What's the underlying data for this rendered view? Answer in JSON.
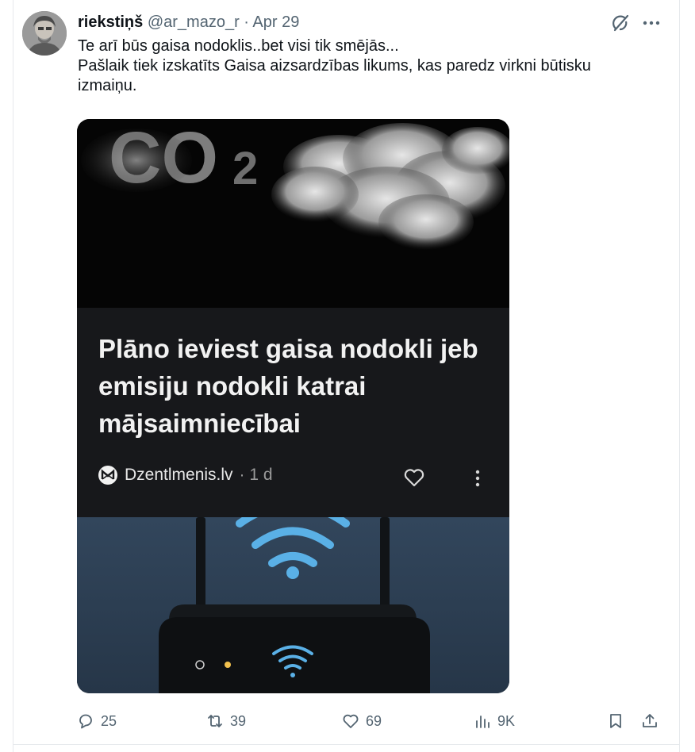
{
  "tweet": {
    "author_name": "riekstiņš",
    "handle": "@ar_mazo_r",
    "separator": "·",
    "date": "Apr 29",
    "text_line1": "Te arī būs gaisa nodoklis..bet visi tik smējās...",
    "text_line2": "Pašlaik tiek izskatīts Gaisa aizsardzības likums, kas paredz virkni būtisku izmaiņu."
  },
  "media": {
    "co2_text": "CO",
    "co2_sub": "2",
    "headline": "Plāno ieviest gaisa nodokli jeb emisiju nodokli katrai mājsaimniecībai",
    "source_name": "Dzentlmenis.lv",
    "source_age": "· 1 d"
  },
  "actions": {
    "replies": "25",
    "reposts": "39",
    "likes": "69",
    "views": "9K"
  },
  "icons": [
    "grok-icon",
    "more-icon",
    "reply-icon",
    "repost-icon",
    "like-icon",
    "views-icon",
    "bookmark-icon",
    "share-icon",
    "heart-icon",
    "kebab-icon",
    "wifi-icon",
    "router-icon"
  ]
}
